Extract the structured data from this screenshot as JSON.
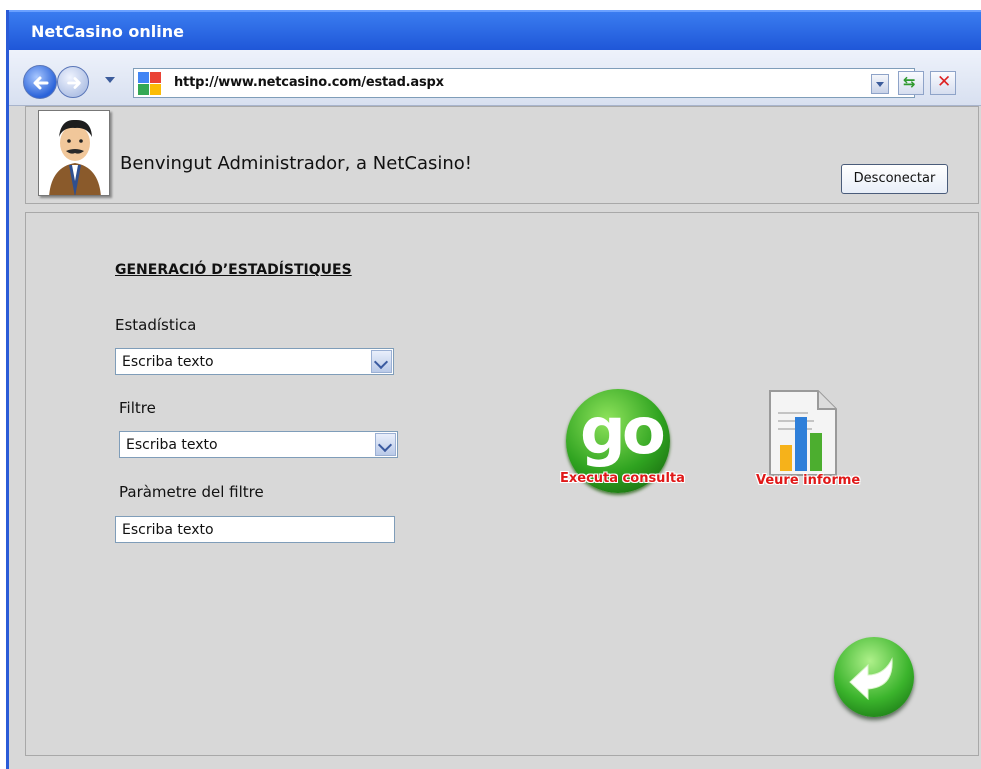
{
  "window": {
    "title": "NetCasino online"
  },
  "browser": {
    "url": "http://www.netcasino.com/estad.aspx",
    "icons": [
      "back-icon",
      "forward-icon",
      "history-dropdown-icon",
      "site-logo-icon",
      "url-dropdown-icon",
      "refresh-icon",
      "stop-icon"
    ]
  },
  "header": {
    "welcome": "Benvingut Administrador, a NetCasino!",
    "disconnect_label": "Desconectar",
    "avatar_icon": "administrator-avatar-icon"
  },
  "form": {
    "section_title": "GENERACIÓ D’ESTADÍSTIQUES",
    "statistic": {
      "label": "Estadística",
      "value": "Escriba texto"
    },
    "filter": {
      "label": "Filtre",
      "value": "Escriba texto"
    },
    "filter_param": {
      "label": "Paràmetre del filtre",
      "value": "Escriba texto"
    }
  },
  "actions": {
    "go_text": "go",
    "execute_label": "Executa consulta",
    "report_label": "Veure informe",
    "back_icon": "return-arrow-icon"
  },
  "colors": {
    "titlebar": "#1f57d8",
    "panel_bg": "#d8d8d8",
    "go_green": "#2fa320",
    "caption_red": "#e01818"
  }
}
